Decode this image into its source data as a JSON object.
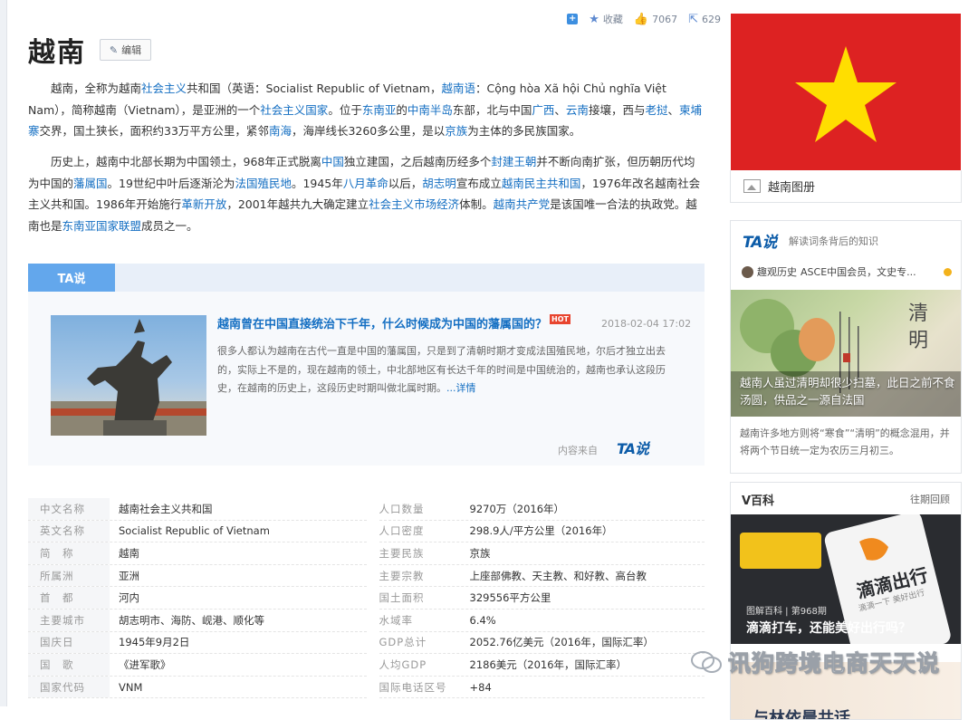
{
  "toolbar": {
    "share_icon": "+",
    "collect_label": "收藏",
    "like_count": "7067",
    "share_count": "629"
  },
  "title": "越南",
  "edit_label": "编辑",
  "para1_segments": [
    {
      "t": "越南，全称为越南"
    },
    {
      "t": "社会主义",
      "link": true
    },
    {
      "t": "共和国（英语：Socialist Republic of Vietnam，"
    },
    {
      "t": "越南语",
      "link": true
    },
    {
      "t": "：Cộng hòa Xã hội Chủ nghĩa Việt Nam），简称越南（Vietnam），是亚洲的一个"
    },
    {
      "t": "社会主义国家",
      "link": true
    },
    {
      "t": "。位于"
    },
    {
      "t": "东南亚",
      "link": true
    },
    {
      "t": "的"
    },
    {
      "t": "中南半岛",
      "link": true
    },
    {
      "t": "东部，北与中国"
    },
    {
      "t": "广西",
      "link": true
    },
    {
      "t": "、"
    },
    {
      "t": "云南",
      "link": true
    },
    {
      "t": "接壤，西与"
    },
    {
      "t": "老挝",
      "link": true
    },
    {
      "t": "、"
    },
    {
      "t": "柬埔寨",
      "link": true
    },
    {
      "t": "交界，国土狭长，面积约33万平方公里，紧邻"
    },
    {
      "t": "南海",
      "link": true
    },
    {
      "t": "，海岸线长3260多公里，是以"
    },
    {
      "t": "京族",
      "link": true
    },
    {
      "t": "为主体的多民族国家。"
    }
  ],
  "para2_segments": [
    {
      "t": "历史上，越南中北部长期为中国领土，968年正式脱离"
    },
    {
      "t": "中国",
      "link": true
    },
    {
      "t": "独立建国，之后越南历经多个"
    },
    {
      "t": "封建王朝",
      "link": true
    },
    {
      "t": "并不断向南扩张，但历朝历代均为中国的"
    },
    {
      "t": "藩属国",
      "link": true
    },
    {
      "t": "。19世纪中叶后逐渐沦为"
    },
    {
      "t": "法国殖民地",
      "link": true
    },
    {
      "t": "。1945年"
    },
    {
      "t": "八月革命",
      "link": true
    },
    {
      "t": "以后，"
    },
    {
      "t": "胡志明",
      "link": true
    },
    {
      "t": "宣布成立"
    },
    {
      "t": "越南民主共和国",
      "link": true
    },
    {
      "t": "，1976年改名越南社会主义共和国。1986年开始施行"
    },
    {
      "t": "革新开放",
      "link": true
    },
    {
      "t": "，2001年越共九大确定建立"
    },
    {
      "t": "社会主义市场经济",
      "link": true
    },
    {
      "t": "体制。"
    },
    {
      "t": "越南共产党",
      "link": true
    },
    {
      "t": "是该国唯一合法的执政党。越南也是"
    },
    {
      "t": "东南亚国家联盟",
      "link": true
    },
    {
      "t": "成员之一。"
    }
  ],
  "ta_section": {
    "tab_label": "TA说",
    "headline": "越南曾在中国直接统治下千年，什么时候成为中国的藩属国的？",
    "hot": "HOT",
    "date": "2018-02-04 17:02",
    "summary": "很多人都认为越南在古代一直是中国的藩属国，只是到了清朝时期才变成法国殖民地，尔后才独立出去的，实际上不是的，现在越南的领土，中北部地区有长达千年的时间是中国统治的，越南也承认这段历史，在越南的历史上，这段历史时期叫做北属时期。",
    "more_link": "...详情",
    "source_label": "内容来自",
    "source_logo": "TA说"
  },
  "info_rows": [
    {
      "l1": "中文名称",
      "v1": "越南社会主义共和国",
      "l2": "人口数量",
      "v2": "9270万（2016年）"
    },
    {
      "l1": "英文名称",
      "v1": "Socialist Republic of Vietnam",
      "l2": "人口密度",
      "v2": "298.9人/平方公里（2016年）"
    },
    {
      "l1": "简　称",
      "v1": "越南",
      "l2": "主要民族",
      "v2": "京族",
      "v2_link": true
    },
    {
      "l1": "所属洲",
      "v1": "亚洲",
      "l2": "主要宗教",
      "v2": "上座部佛教、天主教、和好教、高台教",
      "v2_link": true
    },
    {
      "l1": "首　都",
      "v1": "河内",
      "v1_link": true,
      "l2": "国土面积",
      "v2": "329556平方公里"
    },
    {
      "l1": "主要城市",
      "v1": "胡志明市、海防、岘港、顺化等",
      "v1_link": true,
      "l2": "水域率",
      "v2": "6.4%"
    },
    {
      "l1": "国庆日",
      "v1": "1945年9月2日",
      "l2": "GDP总计",
      "v2": "2052.76亿美元（2016年，国际汇率）"
    },
    {
      "l1": "国　歌",
      "v1": "《进军歌》",
      "v1_link": true,
      "l2": "人均GDP",
      "v2": "2186美元（2016年，国际汇率）"
    },
    {
      "l1": "国家代码",
      "v1": "VNM",
      "l2": "国际电话区号",
      "v2": "+84"
    }
  ],
  "right": {
    "gallery_label": "越南图册",
    "ta_box_logo": "TA说",
    "ta_box_sub": "解读词条背后的知识",
    "author": "趣观历史",
    "author_desc": "ASCE中国会员，文史专...",
    "ta_img_overlay": "清明",
    "ta_box_caption": "越南人虽过清明却很少扫墓，此日之前不食汤圆，供品之一源自法国",
    "ta_box_text": "越南许多地方则将“寒食”“清明”的概念混用，并将两个节日统一定为农历三月初三。",
    "v_title": "V百科",
    "v_more": "往期回顾",
    "v_img_brand": "滴滴出行",
    "v_img_slogan": "滴滴一下 美好出行",
    "v_cat": "图解百科 | 第968期",
    "v_caption": "滴滴打车，还能美好出行吗？",
    "v_next": "与林依晨共话"
  },
  "watermark": "讯狗跨境电商天天说",
  "colors": {
    "link": "#136ec2",
    "flag_red": "#dd2222",
    "flag_star": "#ffde00",
    "ta_tab": "#63a7ec"
  }
}
